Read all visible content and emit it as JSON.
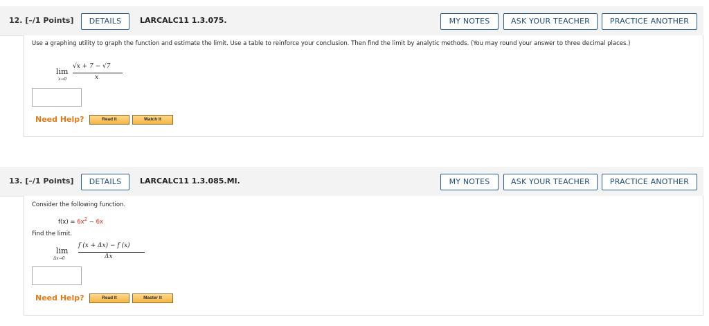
{
  "questions": [
    {
      "number": "12.",
      "points": "[–/1 Points]",
      "details_label": "DETAILS",
      "code": "LARCALC11 1.3.075.",
      "my_notes_label": "MY NOTES",
      "ask_teacher_label": "ASK YOUR TEACHER",
      "practice_label": "PRACTICE ANOTHER",
      "prompt": "Use a graphing utility to graph the function and estimate the limit. Use a table to reinforce your conclusion. Then find the limit by analytic methods. (You may round your answer to three decimal places.)",
      "limit": {
        "word": "lim",
        "sub": "x→0",
        "numerator": "√x + 7 − √7",
        "denominator": "x"
      },
      "answer_value": "",
      "need_help": "Need Help?",
      "help_buttons": [
        "Read It",
        "Watch It"
      ]
    },
    {
      "number": "13.",
      "points": "[–/1 Points]",
      "details_label": "DETAILS",
      "code": "LARCALC11 1.3.085.MI.",
      "my_notes_label": "MY NOTES",
      "ask_teacher_label": "ASK YOUR TEACHER",
      "practice_label": "PRACTICE ANOTHER",
      "intro": "Consider the following function.",
      "function_lhs": "f(x) = ",
      "function_term1": "6x",
      "function_exp": "2",
      "function_minus": " − ",
      "function_term2": "6x",
      "find_text": "Find the limit.",
      "limit": {
        "word": "lim",
        "sub": "Δx→0",
        "numerator": "f (x + Δx) − f (x)",
        "denominator": "Δx"
      },
      "answer_value": "",
      "need_help": "Need Help?",
      "help_buttons": [
        "Read It",
        "Master It"
      ]
    }
  ],
  "colors": {
    "header_bg": "#f3f3f3",
    "button_border": "#2b5d8a",
    "button_text": "#1f4c73",
    "need_help": "#e07b17",
    "help_button": "#f5b442",
    "function_red": "#d9281b"
  }
}
